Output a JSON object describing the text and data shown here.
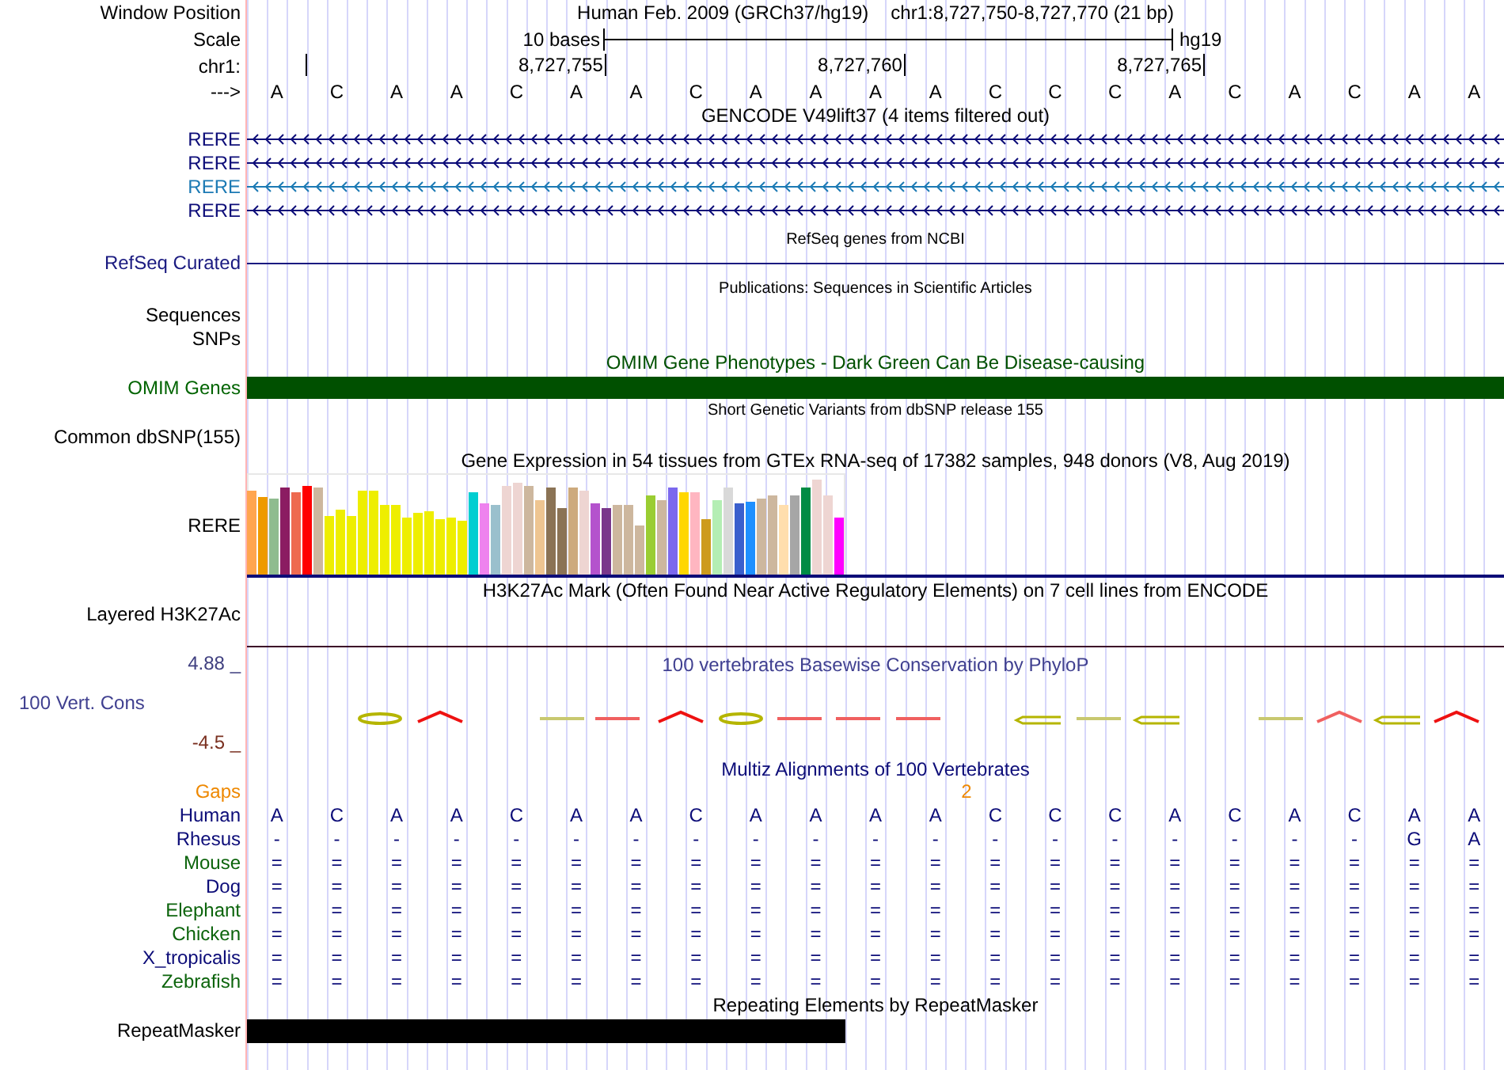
{
  "header": {
    "label": "Window Position",
    "title": "Human Feb. 2009 (GRCh37/hg19)",
    "position": "chr1:8,727,750-8,727,770 (21 bp)"
  },
  "scale": {
    "label": "Scale",
    "text": "10 bases",
    "assembly": "hg19"
  },
  "ruler": {
    "label": "chr1:",
    "ticks": [
      "8,727,755",
      "8,727,760",
      "8,727,765"
    ]
  },
  "sequence": {
    "label": "--->",
    "bases": [
      "A",
      "C",
      "A",
      "A",
      "C",
      "A",
      "A",
      "C",
      "A",
      "A",
      "A",
      "A",
      "C",
      "C",
      "C",
      "A",
      "C",
      "A",
      "C",
      "A",
      "A"
    ]
  },
  "tracks": [
    {
      "kind": "genes",
      "title": "GENCODE V49lift37 (4 items filtered out)",
      "items": [
        {
          "label": "RERE",
          "color": "#0c0c78"
        },
        {
          "label": "RERE",
          "color": "#0c0c78"
        },
        {
          "label": "RERE",
          "color": "#1c7ab4"
        },
        {
          "label": "RERE",
          "color": "#0c0c78"
        }
      ]
    },
    {
      "kind": "line",
      "title": "RefSeq genes from NCBI",
      "label": "RefSeq Curated"
    },
    {
      "kind": "empty",
      "title": "Publications: Sequences in Scientific Articles",
      "labels": [
        "Sequences",
        "SNPs"
      ]
    },
    {
      "kind": "bar",
      "title": "OMIM Gene Phenotypes - Dark Green Can Be Disease-causing",
      "label": "OMIM Genes"
    },
    {
      "kind": "empty",
      "title": "Short Genetic Variants from dbSNP release 155",
      "labels": [
        "Common dbSNP(155)"
      ]
    },
    {
      "kind": "expression",
      "title": "Gene Expression in 54 tissues from GTEx RNA-seq of 17382 samples, 948 donors (V8, Aug 2019)",
      "label": "RERE"
    },
    {
      "kind": "empty",
      "title": "H3K27Ac Mark (Often Found Near Active Regulatory Elements) on 7 cell lines from ENCODE",
      "labels": [
        "Layered H3K27Ac"
      ]
    },
    {
      "kind": "signal",
      "title": "100 vertebrates Basewise Conservation by PhyloP",
      "label": "100 Vert. Cons",
      "max": "4.88 _",
      "min": "-4.5 _"
    },
    {
      "kind": "alignment",
      "title": "Multiz Alignments of 100 Vertebrates",
      "gaps": {
        "label": "Gaps",
        "marks": [
          {
            "text": "2"
          }
        ]
      },
      "species": [
        {
          "name": "Human",
          "color": "#0c0c78",
          "bases": [
            "A",
            "C",
            "A",
            "A",
            "C",
            "A",
            "A",
            "C",
            "A",
            "A",
            "A",
            "A",
            "C",
            "C",
            "C",
            "A",
            "C",
            "A",
            "C",
            "A",
            "A"
          ]
        },
        {
          "name": "Rhesus",
          "color": "#0c0c78",
          "bases": [
            "-",
            "-",
            "-",
            "-",
            "-",
            "-",
            "-",
            "-",
            "-",
            "-",
            "-",
            "-",
            "-",
            "-",
            "-",
            "-",
            "-",
            "-",
            "-",
            "G",
            "A"
          ]
        },
        {
          "name": "Mouse",
          "color": "#0c640c",
          "bases": [
            "=",
            "=",
            "=",
            "=",
            "=",
            "=",
            "=",
            "=",
            "=",
            "=",
            "=",
            "=",
            "=",
            "=",
            "=",
            "=",
            "=",
            "=",
            "=",
            "=",
            "="
          ]
        },
        {
          "name": "Dog",
          "color": "#0c0c78",
          "bases": [
            "=",
            "=",
            "=",
            "=",
            "=",
            "=",
            "=",
            "=",
            "=",
            "=",
            "=",
            "=",
            "=",
            "=",
            "=",
            "=",
            "=",
            "=",
            "=",
            "=",
            "="
          ]
        },
        {
          "name": "Elephant",
          "color": "#0c640c",
          "bases": [
            "=",
            "=",
            "=",
            "=",
            "=",
            "=",
            "=",
            "=",
            "=",
            "=",
            "=",
            "=",
            "=",
            "=",
            "=",
            "=",
            "=",
            "=",
            "=",
            "=",
            "="
          ]
        },
        {
          "name": "Chicken",
          "color": "#0c640c",
          "bases": [
            "=",
            "=",
            "=",
            "=",
            "=",
            "=",
            "=",
            "=",
            "=",
            "=",
            "=",
            "=",
            "=",
            "=",
            "=",
            "=",
            "=",
            "=",
            "=",
            "=",
            "="
          ]
        },
        {
          "name": "X_tropicalis",
          "color": "#0c0c78",
          "bases": [
            "=",
            "=",
            "=",
            "=",
            "=",
            "=",
            "=",
            "=",
            "=",
            "=",
            "=",
            "=",
            "=",
            "=",
            "=",
            "=",
            "=",
            "=",
            "=",
            "=",
            "="
          ]
        },
        {
          "name": "Zebrafish",
          "color": "#0c640c",
          "bases": [
            "=",
            "=",
            "=",
            "=",
            "=",
            "=",
            "=",
            "=",
            "=",
            "=",
            "=",
            "=",
            "=",
            "=",
            "=",
            "=",
            "=",
            "=",
            "=",
            "=",
            "="
          ]
        }
      ]
    },
    {
      "kind": "repeat",
      "title": "Repeating Elements by RepeatMasker",
      "label": "RepeatMasker"
    }
  ]
}
